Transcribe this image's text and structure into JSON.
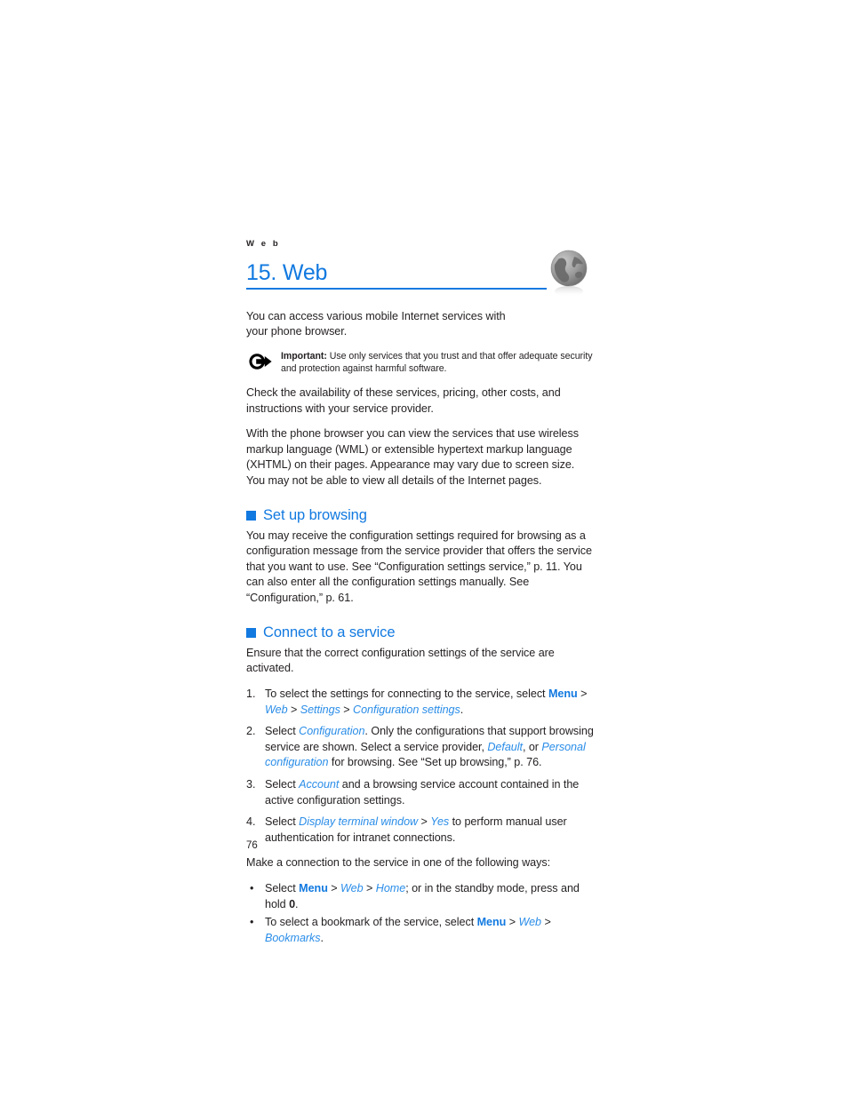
{
  "document": {
    "running_header": "W e b",
    "page_number": "76",
    "accent_color": "#1179e0",
    "link_color": "#2a8de8",
    "text_color": "#231f20"
  },
  "chapter": {
    "title": "15. Web",
    "icon": "globe-icon"
  },
  "intro": {
    "paragraph_1": "You can access various mobile Internet services with your phone browser.",
    "paragraph_2": "Check the availability of these services, pricing, other costs, and instructions with your service provider.",
    "paragraph_3": "With the phone browser you can view the services that use wireless markup language (WML) or extensible hypertext markup language (XHTML) on their pages. Appearance may vary due to screen size. You may not be able to view all details of the Internet pages."
  },
  "note": {
    "icon": "important-arrow-icon",
    "label": "Important:",
    "text": " Use only services that you trust and that offer adequate security and protection against harmful software."
  },
  "sections": {
    "set_up_browsing": {
      "heading": "Set up browsing",
      "paragraph": "You may receive the configuration settings required for browsing as a configuration message from the service provider that offers the service that you want to use. See “Configuration settings service,” p. 11. You can also enter all the configuration settings manually. See “Configuration,” p. 61."
    },
    "connect_to_service": {
      "heading": "Connect to a service",
      "intro": "Ensure that the correct configuration settings of the service are activated.",
      "steps": [
        {
          "number": "1.",
          "parts": [
            {
              "type": "text",
              "value": "To select the settings for connecting to the service, select "
            },
            {
              "type": "ui-bold",
              "value": "Menu"
            },
            {
              "type": "sep",
              "value": " > "
            },
            {
              "type": "ui-italic",
              "value": "Web"
            },
            {
              "type": "sep",
              "value": " > "
            },
            {
              "type": "ui-italic",
              "value": "Settings"
            },
            {
              "type": "sep",
              "value": " > "
            },
            {
              "type": "ui-italic",
              "value": "Configuration settings"
            },
            {
              "type": "text",
              "value": "."
            }
          ]
        },
        {
          "number": "2.",
          "parts": [
            {
              "type": "text",
              "value": "Select "
            },
            {
              "type": "ui-italic",
              "value": "Configuration"
            },
            {
              "type": "text",
              "value": ". Only the configurations that support browsing service are shown. Select a service provider, "
            },
            {
              "type": "ui-italic",
              "value": "Default"
            },
            {
              "type": "text",
              "value": ", or "
            },
            {
              "type": "ui-italic",
              "value": "Personal configuration"
            },
            {
              "type": "text",
              "value": " for browsing. See “Set up browsing,” p. 76."
            }
          ]
        },
        {
          "number": "3.",
          "parts": [
            {
              "type": "text",
              "value": "Select "
            },
            {
              "type": "ui-italic",
              "value": "Account"
            },
            {
              "type": "text",
              "value": " and a browsing service account contained in the active configuration settings."
            }
          ]
        },
        {
          "number": "4.",
          "parts": [
            {
              "type": "text",
              "value": "Select "
            },
            {
              "type": "ui-italic",
              "value": "Display terminal window"
            },
            {
              "type": "sep",
              "value": " > "
            },
            {
              "type": "ui-italic",
              "value": "Yes"
            },
            {
              "type": "text",
              "value": " to perform manual user authentication for intranet connections."
            }
          ]
        }
      ],
      "ways_intro": "Make a connection to the service in one of the following ways:",
      "bullet_marker": "•",
      "bullets": [
        {
          "parts": [
            {
              "type": "text",
              "value": "Select "
            },
            {
              "type": "ui-bold",
              "value": "Menu"
            },
            {
              "type": "sep",
              "value": " > "
            },
            {
              "type": "ui-italic",
              "value": "Web"
            },
            {
              "type": "sep",
              "value": " > "
            },
            {
              "type": "ui-italic",
              "value": "Home"
            },
            {
              "type": "text",
              "value": "; or in the standby mode, press and hold "
            },
            {
              "type": "bold-plain",
              "value": "0"
            },
            {
              "type": "text",
              "value": "."
            }
          ]
        },
        {
          "parts": [
            {
              "type": "text",
              "value": "To select a bookmark of the service, select "
            },
            {
              "type": "ui-bold",
              "value": "Menu"
            },
            {
              "type": "sep",
              "value": " > "
            },
            {
              "type": "ui-italic",
              "value": "Web"
            },
            {
              "type": "sep",
              "value": " > "
            },
            {
              "type": "ui-italic",
              "value": "Bookmarks"
            },
            {
              "type": "text",
              "value": "."
            }
          ]
        }
      ]
    }
  }
}
